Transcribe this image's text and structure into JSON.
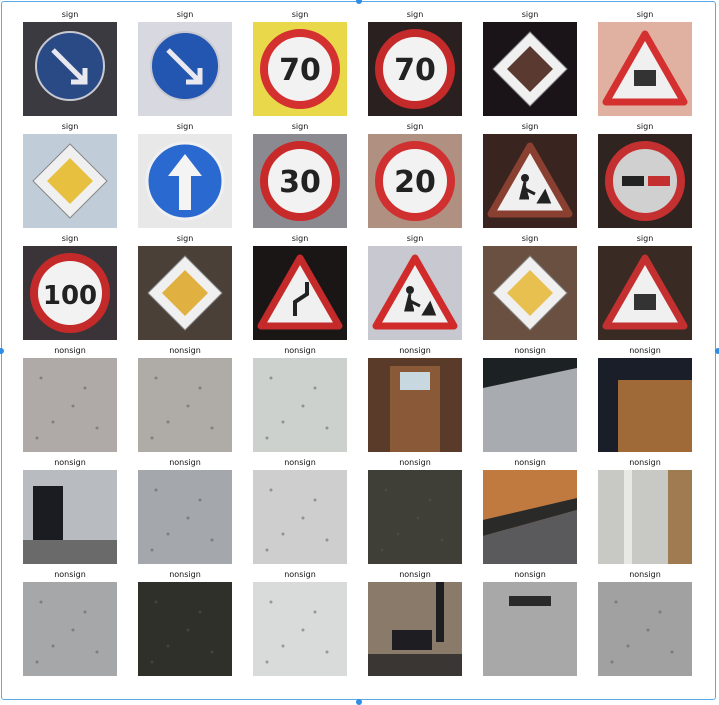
{
  "grid": {
    "columns": 6,
    "rows": 6,
    "images": [
      {
        "label": "sign",
        "icon": "keep-right-sign",
        "bg": "#3a3a40",
        "accent": "#2a4a86"
      },
      {
        "label": "sign",
        "icon": "keep-right-sign",
        "bg": "#d8d8e0",
        "accent": "#2356b0"
      },
      {
        "label": "sign",
        "icon": "speed-limit-70-sign",
        "bg": "#e8d84a",
        "accent": "#d43030"
      },
      {
        "label": "sign",
        "icon": "speed-limit-70-sign",
        "bg": "#2a2020",
        "accent": "#c42a2a"
      },
      {
        "label": "sign",
        "icon": "priority-road-sign",
        "bg": "#1a1418",
        "accent": "#5a3a30"
      },
      {
        "label": "sign",
        "icon": "warning-triangle-sign",
        "bg": "#e0b0a0",
        "accent": "#d43030"
      },
      {
        "label": "sign",
        "icon": "priority-road-sign",
        "bg": "#c0ccd8",
        "accent": "#e8c040"
      },
      {
        "label": "sign",
        "icon": "ahead-only-sign",
        "bg": "#e8e8e8",
        "accent": "#2a6ad0"
      },
      {
        "label": "sign",
        "icon": "speed-limit-30-sign",
        "bg": "#8a8a90",
        "accent": "#c82a2a"
      },
      {
        "label": "sign",
        "icon": "speed-limit-20-sign",
        "bg": "#b09080",
        "accent": "#d03030"
      },
      {
        "label": "sign",
        "icon": "road-work-sign",
        "bg": "#3a2420",
        "accent": "#8a4030"
      },
      {
        "label": "sign",
        "icon": "no-passing-sign",
        "bg": "#302420",
        "accent": "#c43030"
      },
      {
        "label": "sign",
        "icon": "speed-limit-100-sign",
        "bg": "#3a3438",
        "accent": "#c42a2a"
      },
      {
        "label": "sign",
        "icon": "priority-road-sign",
        "bg": "#4a4038",
        "accent": "#e0b040"
      },
      {
        "label": "sign",
        "icon": "curve-warning-sign",
        "bg": "#1a1616",
        "accent": "#c42a2a"
      },
      {
        "label": "sign",
        "icon": "road-work-sign",
        "bg": "#c8c8d0",
        "accent": "#d02a2a"
      },
      {
        "label": "sign",
        "icon": "priority-road-sign",
        "bg": "#6a5040",
        "accent": "#e8c050"
      },
      {
        "label": "sign",
        "icon": "warning-triangle-sign",
        "bg": "#3a2a24",
        "accent": "#c43030"
      },
      {
        "label": "nonsign",
        "icon": "floor-texture",
        "bg": "#a8a4a0",
        "accent": "#bcb8b4"
      },
      {
        "label": "nonsign",
        "icon": "floor-texture",
        "bg": "#aaa6a2",
        "accent": "#bab6b2"
      },
      {
        "label": "nonsign",
        "icon": "floor-texture",
        "bg": "#c8ccc8",
        "accent": "#d8dad8"
      },
      {
        "label": "nonsign",
        "icon": "door-scene",
        "bg": "#5a3a28",
        "accent": "#8a5a38"
      },
      {
        "label": "nonsign",
        "icon": "floor-wall-scene",
        "bg": "#a8acb0",
        "accent": "#1c2224"
      },
      {
        "label": "nonsign",
        "icon": "cabinet-scene",
        "bg": "#a06a38",
        "accent": "#1a1e28"
      },
      {
        "label": "nonsign",
        "icon": "machine-scene",
        "bg": "#b8bcc0",
        "accent": "#1a1c22"
      },
      {
        "label": "nonsign",
        "icon": "floor-texture",
        "bg": "#9ea2a6",
        "accent": "#aeb2b6"
      },
      {
        "label": "nonsign",
        "icon": "floor-texture",
        "bg": "#c8cac8",
        "accent": "#d6d8d6"
      },
      {
        "label": "nonsign",
        "icon": "wall-texture",
        "bg": "#3a3a34",
        "accent": "#4a4a42"
      },
      {
        "label": "nonsign",
        "icon": "table-edge-scene",
        "bg": "#c07a40",
        "accent": "#2a2a28"
      },
      {
        "label": "nonsign",
        "icon": "wall-corner-scene",
        "bg": "#c8c8c4",
        "accent": "#a07a50"
      },
      {
        "label": "nonsign",
        "icon": "floor-texture",
        "bg": "#a0a2a4",
        "accent": "#b0b2b4"
      },
      {
        "label": "nonsign",
        "icon": "wall-texture",
        "bg": "#2a2c26",
        "accent": "#363830"
      },
      {
        "label": "nonsign",
        "icon": "floor-texture",
        "bg": "#d4d8d6",
        "accent": "#e0e2e0"
      },
      {
        "label": "nonsign",
        "icon": "chair-scene",
        "bg": "#8a7a6a",
        "accent": "#1e1e22"
      },
      {
        "label": "nonsign",
        "icon": "floor-grate-scene",
        "bg": "#a8a8a8",
        "accent": "#2a2a2a"
      },
      {
        "label": "nonsign",
        "icon": "floor-texture",
        "bg": "#9c9c9c",
        "accent": "#acacac"
      }
    ]
  }
}
